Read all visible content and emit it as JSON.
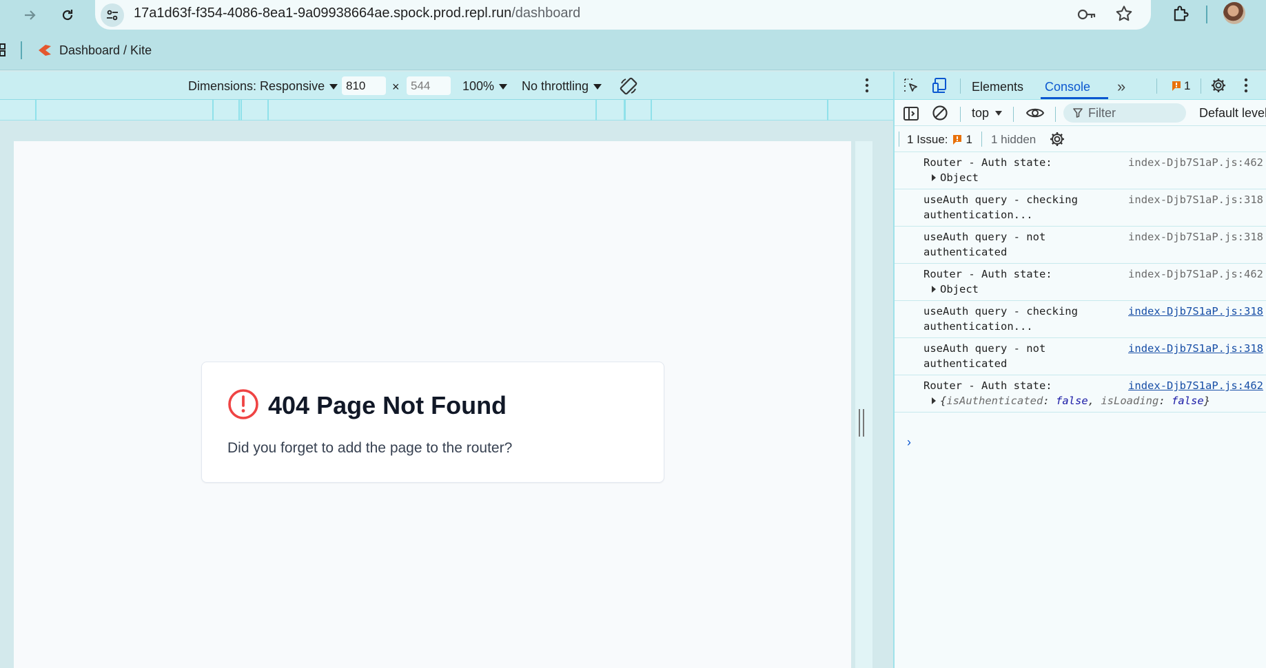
{
  "browser": {
    "url_host": "17a1d63f-f354-4086-8ea1-9a09938664ae.spock.prod.repl.run",
    "url_path": "/dashboard",
    "bookmark": "Dashboard / Kite"
  },
  "device_toolbar": {
    "dimensions_label": "Dimensions: Responsive",
    "width": "810",
    "height_placeholder": "544",
    "times": "×",
    "zoom": "100%",
    "throttling": "No throttling"
  },
  "page": {
    "title": "404 Page Not Found",
    "message": "Did you forget to add the page to the router?",
    "alert_color": "#ef4444"
  },
  "devtools": {
    "tabs": {
      "elements": "Elements",
      "console": "Console",
      "more": "»"
    },
    "issue_badge_count": "1",
    "context": "top",
    "filter_placeholder": "Filter",
    "default_levels": "Default levels",
    "issues_label": "1 Issue:",
    "issues_count": "1",
    "hidden_label": "1 hidden",
    "log": [
      {
        "msg": "Router - Auth state:",
        "src": "index-Djb7S1aP.js:462",
        "obj": "Object"
      },
      {
        "msg": "useAuth query - checking authentication...",
        "src": "index-Djb7S1aP.js:318"
      },
      {
        "msg": "useAuth query - not authenticated",
        "src": "index-Djb7S1aP.js:318"
      },
      {
        "msg": "Router - Auth state:",
        "src": "index-Djb7S1aP.js:462",
        "obj": "Object"
      },
      {
        "msg": "useAuth query - checking authentication...",
        "src": "index-Djb7S1aP.js:318"
      },
      {
        "msg": "useAuth query - not authenticated",
        "src": "index-Djb7S1aP.js:318"
      },
      {
        "msg": "Router - Auth state:",
        "src": "index-Djb7S1aP.js:462",
        "obj_open": "{",
        "k1": "isAuthenticated",
        "v1": "false",
        "k2": "isLoading",
        "v2": "false",
        "obj_close": "}"
      }
    ],
    "prompt": "›"
  }
}
